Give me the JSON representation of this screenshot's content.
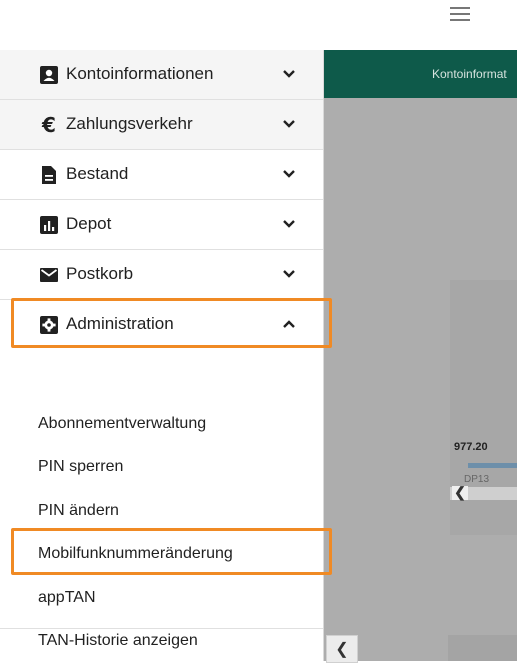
{
  "colors": {
    "accent": "#f08a24",
    "header": "#0e5a4a",
    "overlay": "#adadad"
  },
  "topbar": {
    "menu_icon": "hamburger-icon"
  },
  "sidebar": {
    "items": [
      {
        "label": "Kontoinformationen",
        "icon": "contact-card-icon",
        "expanded": false
      },
      {
        "label": "Zahlungsverkehr",
        "icon": "euro-icon",
        "expanded": false
      },
      {
        "label": "Bestand",
        "icon": "document-icon",
        "expanded": false
      },
      {
        "label": "Depot",
        "icon": "bar-chart-icon",
        "expanded": false
      },
      {
        "label": "Postkorb",
        "icon": "envelope-icon",
        "expanded": false
      },
      {
        "label": "Administration",
        "icon": "gear-icon",
        "expanded": true
      }
    ],
    "admin_subitems": [
      {
        "label": "Abonnementverwaltung"
      },
      {
        "label": "PIN sperren"
      },
      {
        "label": "PIN ändern"
      },
      {
        "label": "Mobilfunknummeränderung"
      },
      {
        "label": "appTAN"
      },
      {
        "label": "TAN-Historie anzeigen"
      }
    ]
  },
  "content": {
    "header_text": "Kontoinformat",
    "card_value": "977.20",
    "card_sub": "DP13",
    "scroll_left_glyph": "❮",
    "bottom_button_glyph": "❮"
  }
}
